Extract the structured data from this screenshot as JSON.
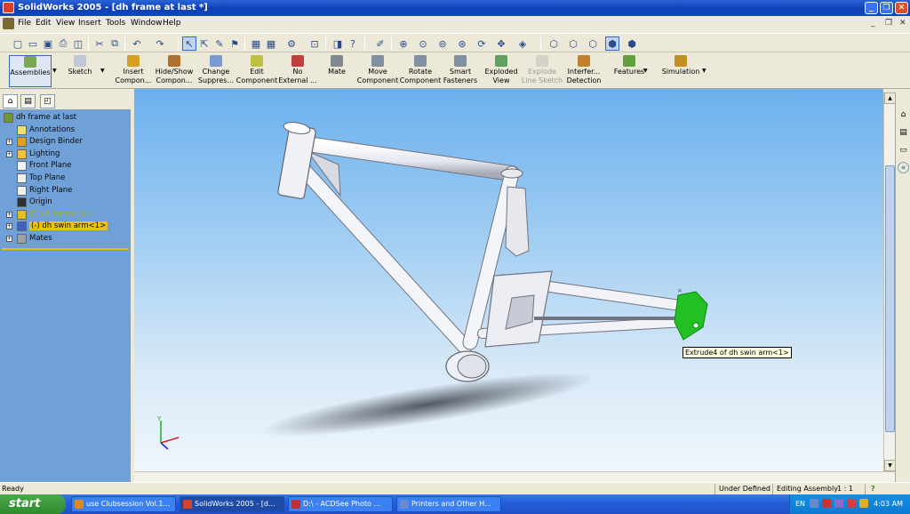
{
  "window": {
    "title": "SolidWorks 2005 - [dh frame at last *]"
  },
  "menu": {
    "items": [
      "File",
      "Edit",
      "View",
      "Insert",
      "Tools",
      "Window",
      "Help"
    ]
  },
  "toolbar_icons": [
    "new-icon",
    "open-icon",
    "save-icon",
    "print-icon",
    "print-preview-icon",
    "cut-icon",
    "copy-icon",
    "undo-icon",
    "redo-icon",
    "select-icon",
    "select-similar-icon",
    "sketch-icon",
    "rebuild-icon",
    "options-icon",
    "grid-icon",
    "layers-icon",
    "zoom-to-fit-icon",
    "zoom-area-icon",
    "zoom-in-out-icon",
    "zoom-selection-icon",
    "rotate-view-icon",
    "pan-icon",
    "standard-views-icon",
    "wireframe-icon",
    "hidden-lines-visible-icon",
    "hidden-lines-removed-icon",
    "shaded-with-edges-icon",
    "shaded-icon"
  ],
  "command_manager": {
    "assemblies": "Assemblies",
    "sketch": "Sketch",
    "buttons": [
      {
        "id": "insert-component",
        "l1": "Insert",
        "l2": "Compon...",
        "enabled": true
      },
      {
        "id": "hide-show",
        "l1": "Hide/Show",
        "l2": "Compon...",
        "enabled": true
      },
      {
        "id": "change-suppress",
        "l1": "Change",
        "l2": "Suppres...",
        "enabled": true
      },
      {
        "id": "edit-component",
        "l1": "Edit",
        "l2": "Component",
        "enabled": true
      },
      {
        "id": "no-external",
        "l1": "No",
        "l2": "External ...",
        "enabled": true
      },
      {
        "id": "mate",
        "l1": "Mate",
        "l2": "",
        "enabled": true
      },
      {
        "id": "move-component",
        "l1": "Move",
        "l2": "Component",
        "enabled": true
      },
      {
        "id": "rotate-component",
        "l1": "Rotate",
        "l2": "Component",
        "enabled": true
      },
      {
        "id": "smart-fasteners",
        "l1": "Smart",
        "l2": "Fasteners",
        "enabled": true
      },
      {
        "id": "exploded-view",
        "l1": "Exploded",
        "l2": "View",
        "enabled": true
      },
      {
        "id": "explode-line-sketch",
        "l1": "Explode",
        "l2": "Line Sketch",
        "enabled": false
      },
      {
        "id": "interference-detection",
        "l1": "Interfer...",
        "l2": "Detection",
        "enabled": true
      },
      {
        "id": "features",
        "l1": "Features",
        "l2": "",
        "enabled": true
      },
      {
        "id": "simulation",
        "l1": "Simulation",
        "l2": "",
        "enabled": true
      }
    ]
  },
  "feature_tree": {
    "items": [
      {
        "label": "dh frame at last",
        "icon": "assembly-icon",
        "expand": false,
        "indent": 0
      },
      {
        "label": "Annotations",
        "icon": "annotations-icon",
        "expand": false,
        "indent": 1
      },
      {
        "label": "Design Binder",
        "icon": "design-binder-icon",
        "expand": true,
        "indent": 1
      },
      {
        "label": "Lighting",
        "icon": "lighting-icon",
        "expand": true,
        "indent": 1
      },
      {
        "label": "Front Plane",
        "icon": "plane-icon",
        "expand": false,
        "indent": 1
      },
      {
        "label": "Top Plane",
        "icon": "plane-icon",
        "expand": false,
        "indent": 1
      },
      {
        "label": "Right Plane",
        "icon": "plane-icon",
        "expand": false,
        "indent": 1
      },
      {
        "label": "Origin",
        "icon": "origin-icon",
        "expand": false,
        "indent": 1
      },
      {
        "label": "(f) dh frame<1>",
        "icon": "part-warning-icon",
        "expand": true,
        "indent": 1
      },
      {
        "label": "(-) dh swin arm<1>",
        "icon": "part-icon",
        "expand": true,
        "indent": 1,
        "selected": true
      },
      {
        "label": "Mates",
        "icon": "mates-icon",
        "expand": true,
        "indent": 1
      }
    ]
  },
  "graphics": {
    "tooltip": "Extrude4 of dh swin arm<1>"
  },
  "status": {
    "left": "Ready",
    "definition": "Under Defined",
    "mode": "Editing Assembly",
    "scale": "1 : 1"
  },
  "taskbar": {
    "start": "start",
    "tasks": [
      {
        "label": "use Clubsession Vol.1...",
        "active": false,
        "color": "#e08a20"
      },
      {
        "label": "SolidWorks 2005 - [d...",
        "active": true,
        "color": "#d9402a"
      },
      {
        "label": "D:\\ - ACDSee Photo ...",
        "active": false,
        "color": "#c03030"
      },
      {
        "label": "Printers and Other H...",
        "active": false,
        "color": "#6a8ad0"
      }
    ],
    "lang": "EN",
    "clock": "4:03 AM"
  },
  "colors": {
    "titlebar": "#0f3fb4",
    "tree_bg": "#6fa0d8",
    "selected_face": "#22c022",
    "taskbar": "#245edb"
  }
}
